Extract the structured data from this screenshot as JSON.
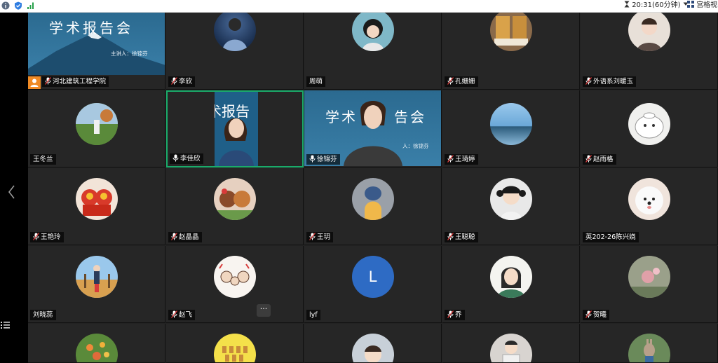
{
  "topbar": {
    "time": "20:31(60分钟)",
    "view_label": "宫格视"
  },
  "colors": {
    "active_border": "#1aab6a",
    "host_badge": "#f08a24",
    "avatar_L": "#2e6bc4"
  },
  "banner": {
    "title": "学术报告会",
    "subtitle": "主讲人：徐锦芬"
  },
  "video_banner": {
    "title_left": "学术",
    "title_right": "告会",
    "subtitle": "人：徐锦芬",
    "left_text": "术报告"
  },
  "participants": [
    {
      "name": "河北建筑工程学院",
      "host": true
    },
    {
      "name": "李欣",
      "mic": true
    },
    {
      "name": "周萌"
    },
    {
      "name": "孔姗姗",
      "mic": true
    },
    {
      "name": "外语系刘暖玉",
      "mic": true
    },
    {
      "name": "王冬兰"
    },
    {
      "name": "李佳欣",
      "mic": true,
      "speaking": true
    },
    {
      "name": "徐锦芬",
      "mic": true
    },
    {
      "name": "王琦婷",
      "mic": true
    },
    {
      "name": "赵雨格",
      "mic": true
    },
    {
      "name": "王艳玲",
      "mic": true
    },
    {
      "name": "赵晶晶",
      "mic": true
    },
    {
      "name": "王玥",
      "mic": true
    },
    {
      "name": "王聪聪",
      "mic": true
    },
    {
      "name": "英202-26陈兴娆"
    },
    {
      "name": "刘晓蕊"
    },
    {
      "name": "赵飞",
      "mic": true
    },
    {
      "name": "lyf"
    },
    {
      "name": "乔",
      "mic": true
    },
    {
      "name": "贺曦",
      "mic": true
    },
    {
      "name": ""
    },
    {
      "name": ""
    },
    {
      "name": ""
    },
    {
      "name": ""
    },
    {
      "name": ""
    }
  ],
  "letter_avatar": "L",
  "more_button": "···",
  "icons": [
    "info-icon",
    "shield-icon",
    "signal-icon",
    "hourglass-icon",
    "dropdown-icon",
    "grid-view-icon",
    "left-arrow-icon",
    "list-icon",
    "mic-icon"
  ]
}
